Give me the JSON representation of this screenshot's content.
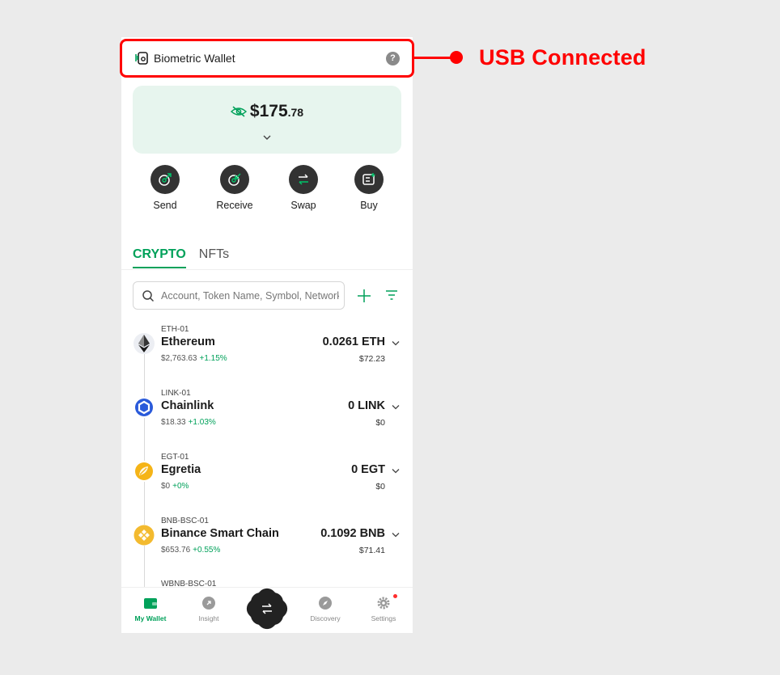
{
  "header": {
    "wallet_name": "Biometric Wallet",
    "help_label": "?"
  },
  "annotation": {
    "label": "USB Connected",
    "color": "#ff0000"
  },
  "balance": {
    "main": "$175",
    "cents": ".78"
  },
  "actions": [
    {
      "label": "Send",
      "icon": "send-icon"
    },
    {
      "label": "Receive",
      "icon": "receive-icon"
    },
    {
      "label": "Swap",
      "icon": "swap-icon"
    },
    {
      "label": "Buy",
      "icon": "buy-icon"
    }
  ],
  "tabs": [
    {
      "label": "CRYPTO",
      "active": true
    },
    {
      "label": "NFTs",
      "active": false
    }
  ],
  "search": {
    "placeholder": "Account, Token Name, Symbol, Network",
    "value": ""
  },
  "tokens": [
    {
      "account": "ETH-01",
      "name": "Ethereum",
      "price": "$2,763.63",
      "change": "+1.15%",
      "amount": "0.0261 ETH",
      "usd": "$72.23",
      "icon": "ethereum-logo"
    },
    {
      "account": "LINK-01",
      "name": "Chainlink",
      "price": "$18.33",
      "change": "+1.03%",
      "amount": "0 LINK",
      "usd": "$0",
      "icon": "chainlink-logo"
    },
    {
      "account": "EGT-01",
      "name": "Egretia",
      "price": "$0",
      "change": "+0%",
      "amount": "0 EGT",
      "usd": "$0",
      "icon": "egretia-logo"
    },
    {
      "account": "BNB-BSC-01",
      "name": "Binance Smart Chain",
      "price": "$653.76",
      "change": "+0.55%",
      "amount": "0.1092 BNB",
      "usd": "$71.41",
      "icon": "bnb-logo"
    },
    {
      "account": "WBNB-BSC-01"
    }
  ],
  "nav": [
    {
      "label": "My Wallet",
      "active": true
    },
    {
      "label": "Insight",
      "active": false
    },
    {
      "label": "Discovery",
      "active": false
    },
    {
      "label": "Settings",
      "active": false
    }
  ],
  "colors": {
    "accent": "#00a15a",
    "card": "#e7f5ee",
    "dark": "#333333",
    "annotation": "#ff0000"
  }
}
